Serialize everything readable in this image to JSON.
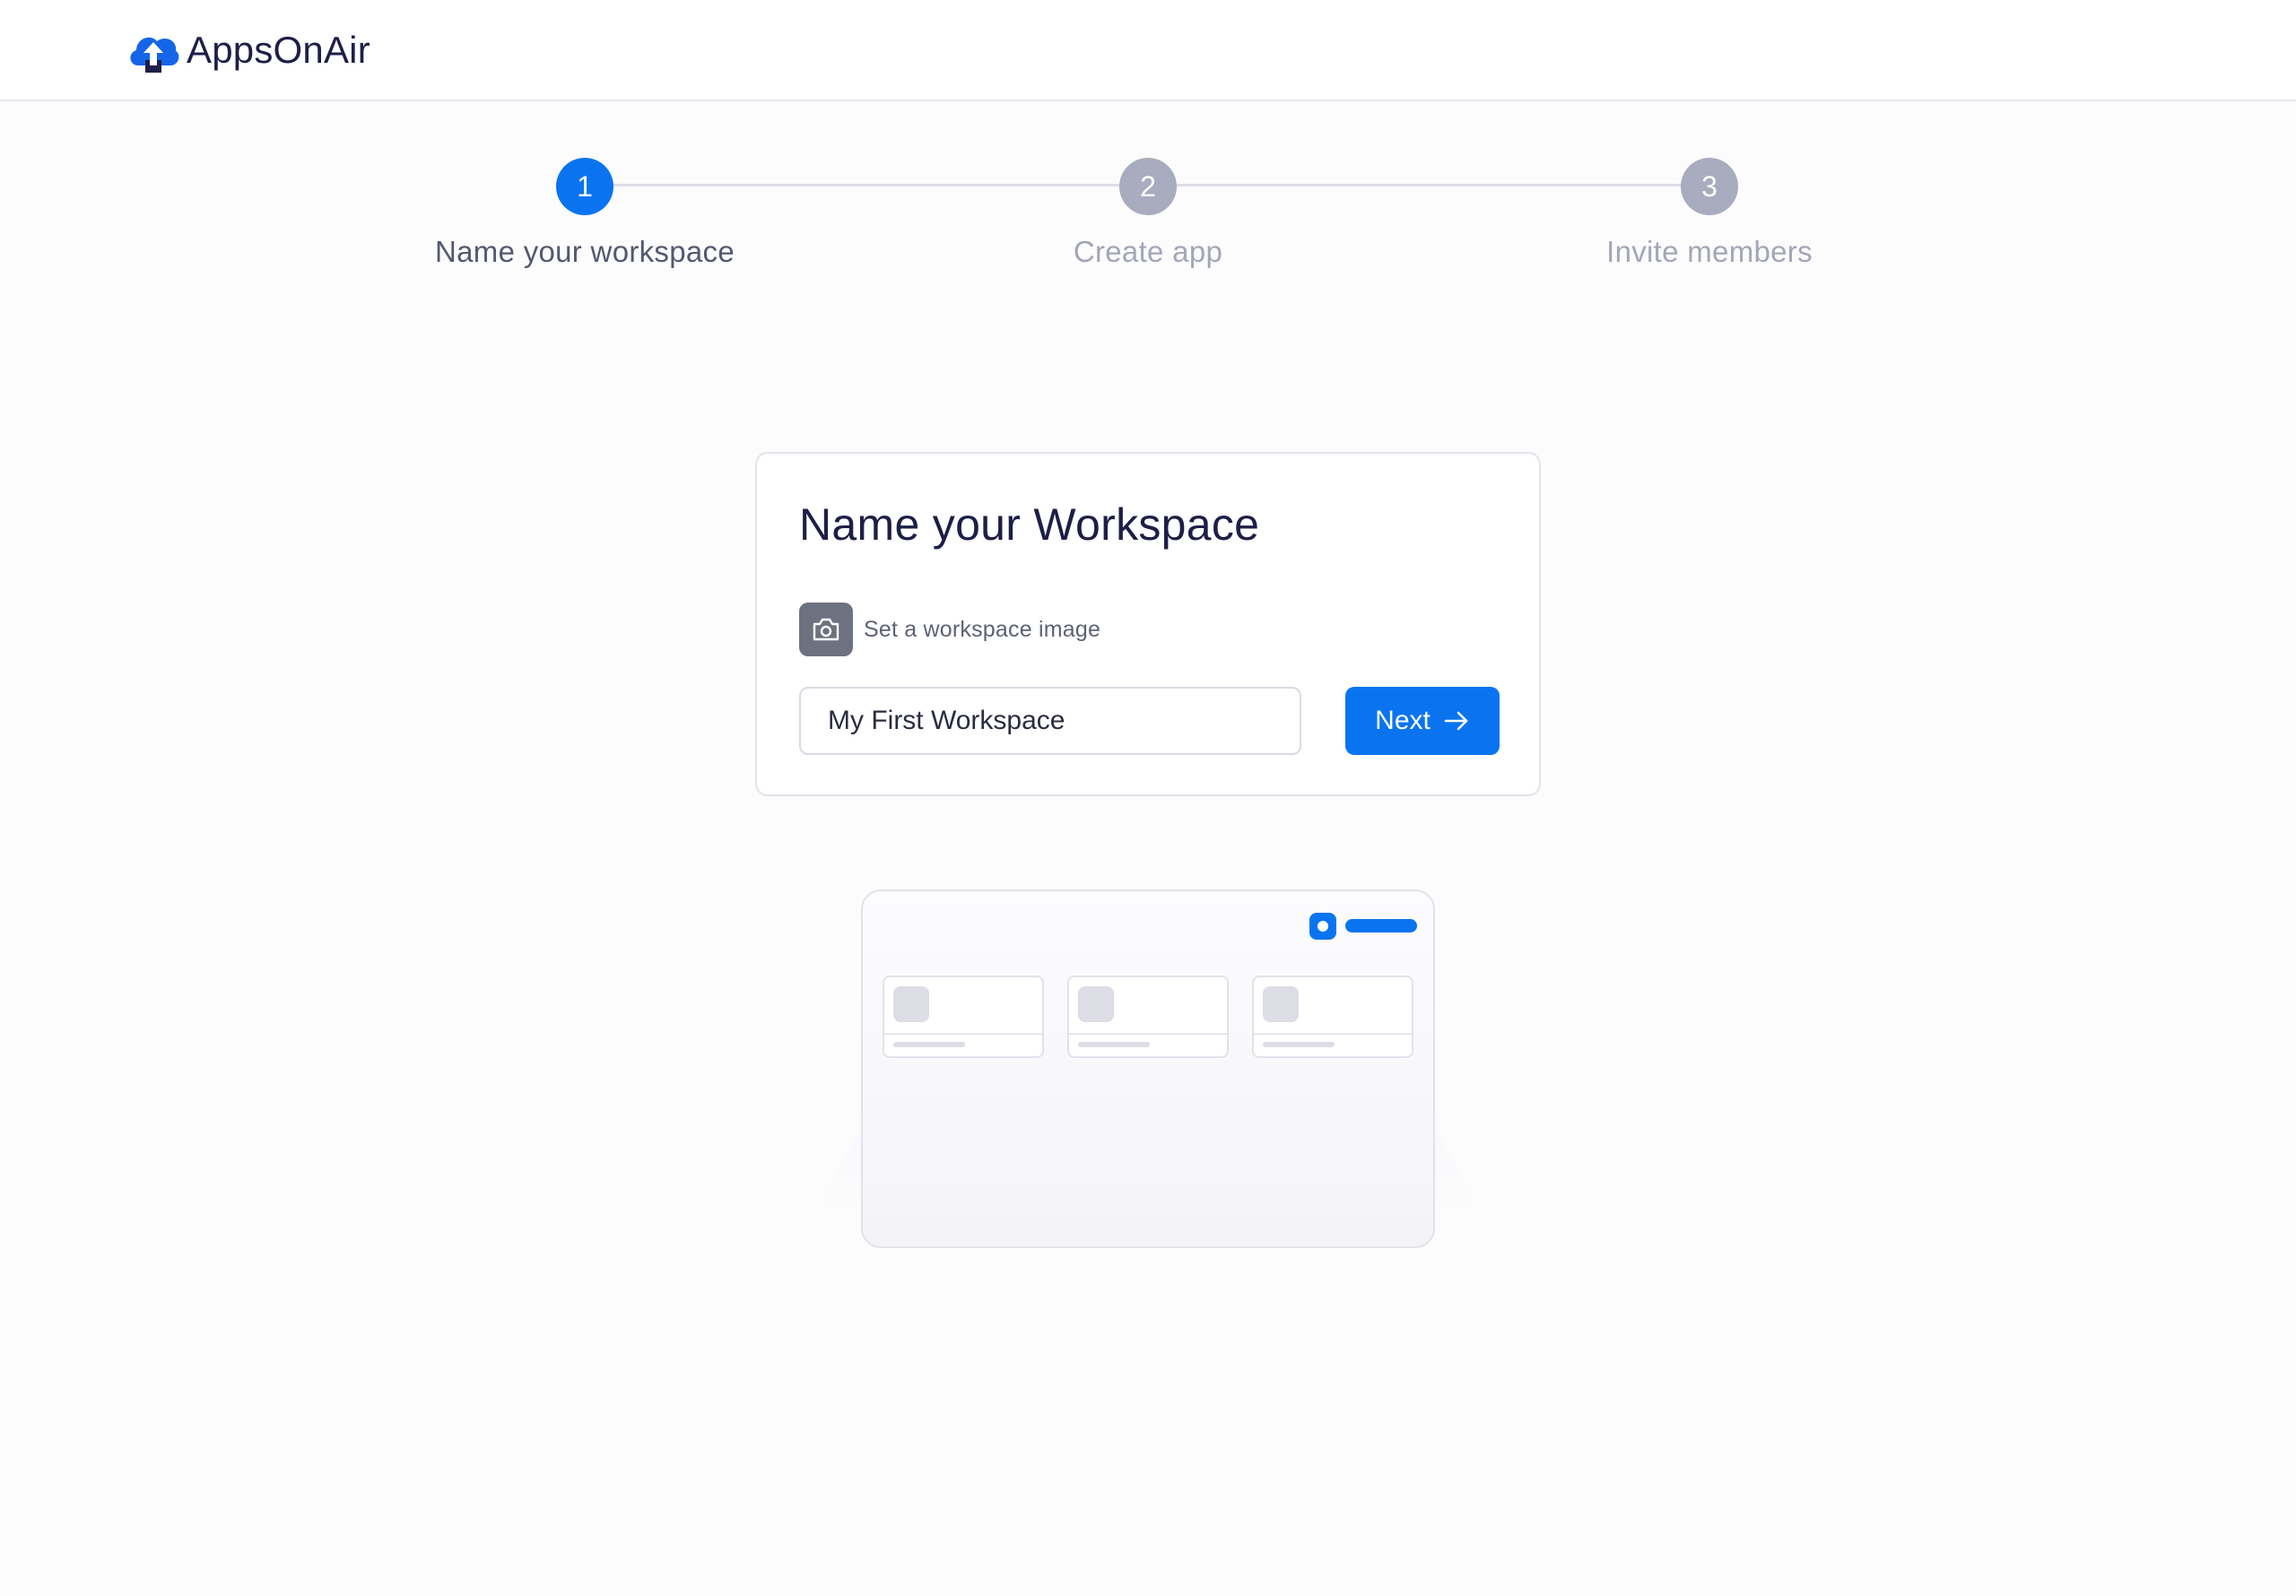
{
  "brand": {
    "name": "AppsOnAir"
  },
  "stepper": {
    "steps": [
      {
        "number": "1",
        "label": "Name your workspace",
        "state": "active"
      },
      {
        "number": "2",
        "label": "Create app",
        "state": "inactive"
      },
      {
        "number": "3",
        "label": "Invite members",
        "state": "inactive"
      }
    ]
  },
  "card": {
    "title": "Name your Workspace",
    "image_label": "Set a workspace image",
    "workspace_name_value": "My First Workspace",
    "next_label": "Next"
  },
  "colors": {
    "accent": "#0a74f0",
    "inactive_step": "#a9abbe",
    "title_text": "#1e1e48"
  },
  "icons": {
    "logo": "cloud-upload-logo-icon",
    "image_button": "camera-icon",
    "next_arrow": "arrow-right-icon"
  }
}
